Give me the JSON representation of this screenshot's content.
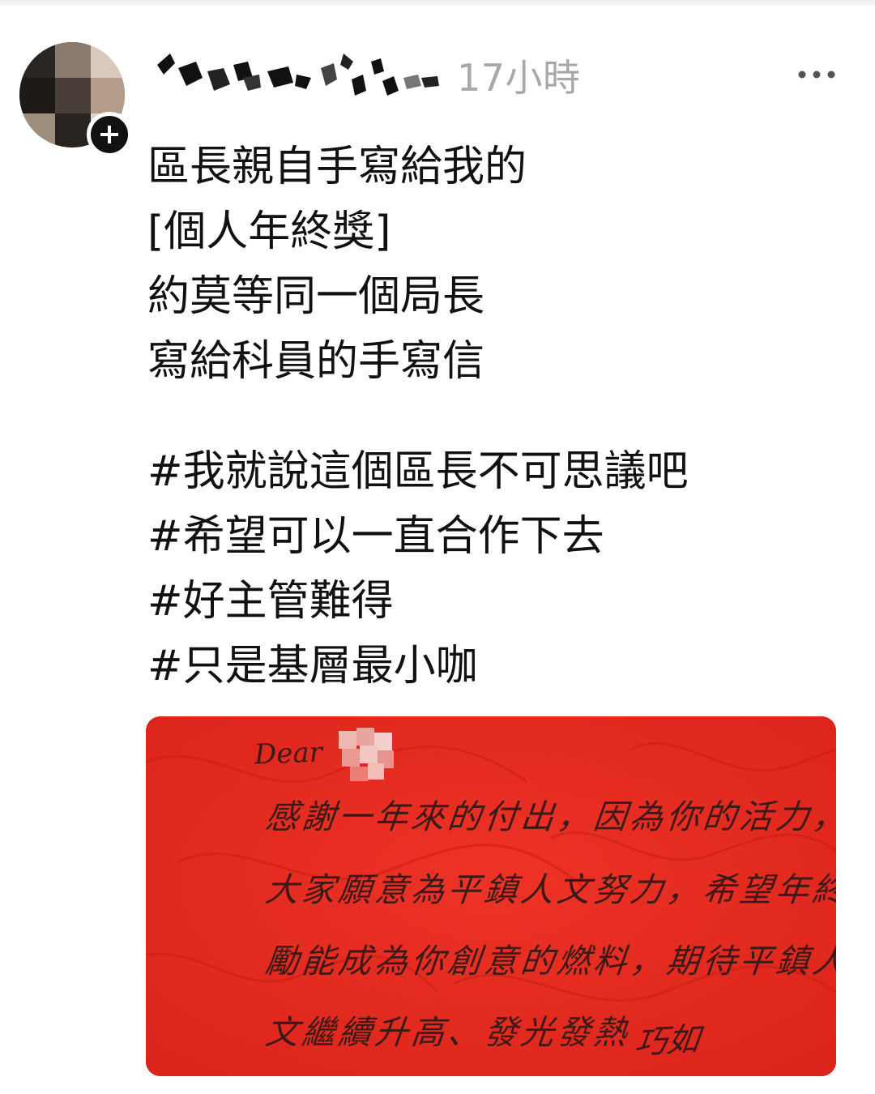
{
  "post": {
    "timestamp": "17小時",
    "caption_lines": [
      "區長親自手寫給我的",
      "[個人年終獎]",
      "約莫等同一個局長",
      "寫給科員的手寫信"
    ],
    "hashtags": [
      "#我就說這個區長不可思議吧",
      "#希望可以一直合作下去",
      "#好主管難得",
      "#只是基層最小咖"
    ]
  },
  "letter": {
    "greeting": "Dear",
    "lines": [
      "感謝一年來的付出，因為你的活力，讓",
      "大家願意為平鎮人文努力，希望年終小獎",
      "勵能成為你創意的燃料，期待平鎮人",
      "文繼續升高、發光發熱"
    ],
    "signature": "巧如"
  },
  "icons": {
    "follow": "plus-icon",
    "more": "more-horizontal-icon"
  },
  "colors": {
    "card_red": "#e82d21",
    "timestamp_gray": "#a8a8a8",
    "text": "#111111"
  }
}
